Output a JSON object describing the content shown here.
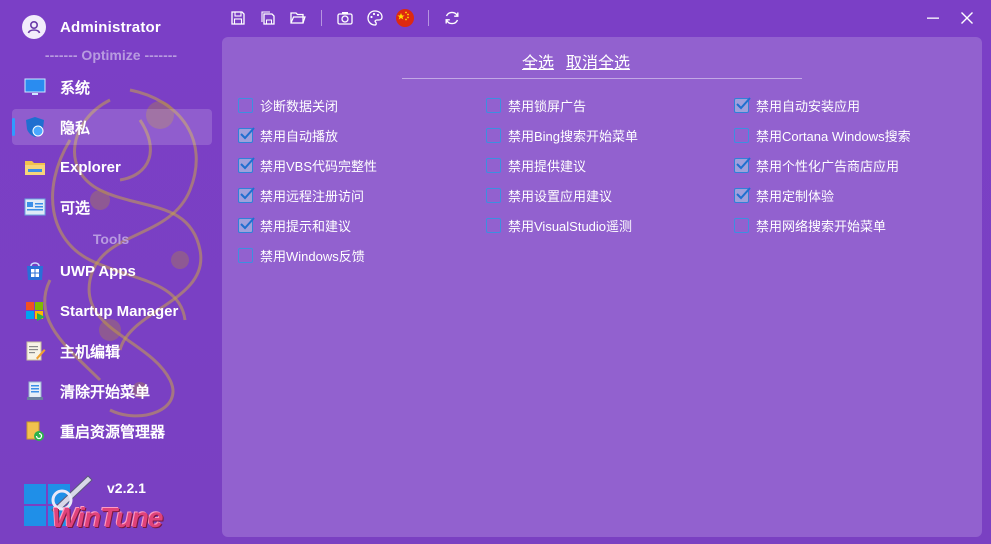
{
  "user": {
    "name": "Administrator"
  },
  "sections": {
    "optimize": "------- Optimize -------",
    "tools": "Tools"
  },
  "nav": [
    {
      "label": "系统",
      "icon": "monitor-icon"
    },
    {
      "label": "隐私",
      "icon": "shield-icon",
      "active": true
    },
    {
      "label": "Explorer",
      "icon": "folder-icon"
    },
    {
      "label": "可选",
      "icon": "options-icon"
    },
    {
      "label": "UWP Apps",
      "icon": "windows-store-icon"
    },
    {
      "label": "Startup Manager",
      "icon": "startup-icon"
    },
    {
      "label": "主机编辑",
      "icon": "hosts-edit-icon"
    },
    {
      "label": "清除开始菜单",
      "icon": "clean-start-icon"
    },
    {
      "label": "重启资源管理器",
      "icon": "restart-explorer-icon"
    }
  ],
  "app": {
    "version": "v2.2.1",
    "logo_text": "WinTune"
  },
  "toolbar": {
    "icons": [
      "save-icon",
      "save-as-icon",
      "open-folder-icon",
      "screenshot-icon",
      "theme-palette-icon",
      "china-flag-icon",
      "refresh-icon"
    ]
  },
  "panel": {
    "select_all": "全选",
    "deselect_all": "取消全选",
    "options": [
      {
        "label": "诊断数据关闭",
        "checked": false
      },
      {
        "label": "禁用自动播放",
        "checked": true
      },
      {
        "label": "禁用VBS代码完整性",
        "checked": true
      },
      {
        "label": "禁用远程注册访问",
        "checked": true
      },
      {
        "label": "禁用提示和建议",
        "checked": true
      },
      {
        "label": "禁用Windows反馈",
        "checked": false
      },
      {
        "label": "禁用锁屏广告",
        "checked": false
      },
      {
        "label": "禁用Bing搜索开始菜单",
        "checked": false
      },
      {
        "label": "禁用提供建议",
        "checked": false
      },
      {
        "label": "禁用设置应用建议",
        "checked": false
      },
      {
        "label": "禁用VisualStudio遥测",
        "checked": false
      },
      {
        "label": "禁用自动安装应用",
        "checked": true
      },
      {
        "label": "禁用Cortana Windows搜索",
        "checked": false
      },
      {
        "label": "禁用个性化广告商店应用",
        "checked": true
      },
      {
        "label": "禁用定制体验",
        "checked": true
      },
      {
        "label": "禁用网络搜索开始菜单",
        "checked": false
      }
    ]
  },
  "colors": {
    "accent": "#2f82d8",
    "background": "#7b3fc6",
    "panel": "#9261cf"
  }
}
